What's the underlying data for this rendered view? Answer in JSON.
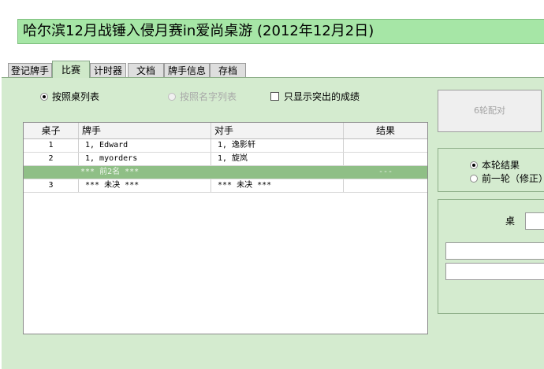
{
  "title": "哈尔滨12月战锤入侵月赛in爱尚桌游 (2012年12月2日)",
  "tabs": [
    {
      "label": "登记牌手",
      "active": false
    },
    {
      "label": "比赛",
      "active": true
    },
    {
      "label": "计时器",
      "active": false
    },
    {
      "label": "文档",
      "active": false
    },
    {
      "label": "牌手信息",
      "active": false
    },
    {
      "label": "存档",
      "active": false
    }
  ],
  "view_options": {
    "by_table": {
      "label": "按照桌列表",
      "selected": true
    },
    "by_name": {
      "label": "按照名字列表",
      "selected": false,
      "disabled": true
    },
    "only_outstanding": {
      "label": "只显示突出的成绩",
      "checked": false
    }
  },
  "grid": {
    "columns": [
      "桌子",
      "牌手",
      "对手",
      "结果"
    ],
    "rows": [
      {
        "table": "1",
        "player": "1, Edward",
        "opponent": "1, 逸影轩",
        "result": "",
        "highlighted": false
      },
      {
        "table": "2",
        "player": "1, myorders",
        "opponent": "1, 旋岚",
        "result": "",
        "highlighted": false
      },
      {
        "table": "",
        "player": "*** 前2名 ***",
        "opponent": "",
        "result": "---",
        "highlighted": true
      },
      {
        "table": "3",
        "player": "*** 未决 ***",
        "opponent": "*** 未决 ***",
        "result": "",
        "highlighted": false
      }
    ]
  },
  "pair_button": {
    "label": "6轮配对",
    "disabled": true
  },
  "round_options": {
    "current": {
      "label": "本轮结果",
      "selected": true
    },
    "previous": {
      "label": "前一轮（修正）",
      "selected": false
    }
  },
  "table_entry": {
    "label": "桌",
    "value": ""
  },
  "player_fields": [
    {
      "value": ""
    },
    {
      "value": ""
    }
  ],
  "colors": {
    "title_bg": "#a6e6a6",
    "panel_bg": "#d4ebcf",
    "highlight_row": "#8fbf86"
  }
}
